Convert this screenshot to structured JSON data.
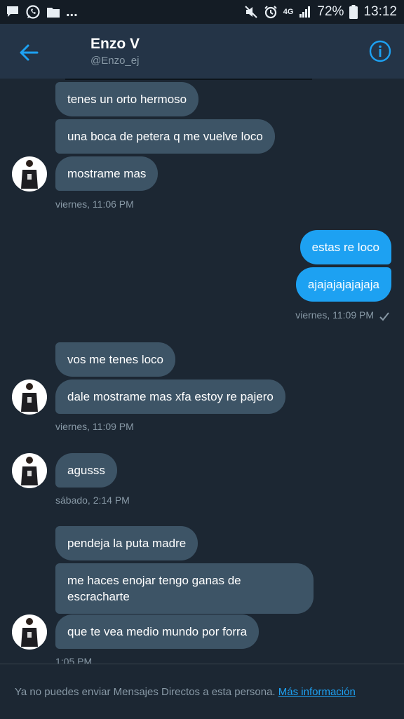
{
  "status_bar": {
    "battery_percent": "72%",
    "time": "13:12",
    "network": "4G",
    "more": "..."
  },
  "header": {
    "name": "Enzo V",
    "handle": "@Enzo_ej"
  },
  "messages": {
    "m1": "tenes un orto hermoso",
    "m2": "una boca de petera q me vuelve loco",
    "m3": "mostrame mas",
    "t1": "viernes, 11:06 PM",
    "o1": "estas re loco",
    "o2": "ajajajajajajaja",
    "t2": "viernes, 11:09 PM",
    "m4": "vos me tenes loco",
    "m5": "dale mostrame mas xfa estoy re pajero",
    "t3": "viernes, 11:09 PM",
    "m6": "agusss",
    "t4": "sábado, 2:14 PM",
    "m7": "pendeja la puta madre",
    "m8": "me haces enojar tengo ganas de escracharte",
    "m9": "que te vea medio mundo por forra",
    "t5": "1:05 PM"
  },
  "footer": {
    "text": "Ya no puedes enviar Mensajes Directos a esta persona.",
    "link": "Más información"
  },
  "colors": {
    "background": "#1c2733",
    "appbar": "#243447",
    "incoming_bubble": "#3d5466",
    "outgoing_bubble": "#1da1f2",
    "accent": "#1da1f2"
  }
}
